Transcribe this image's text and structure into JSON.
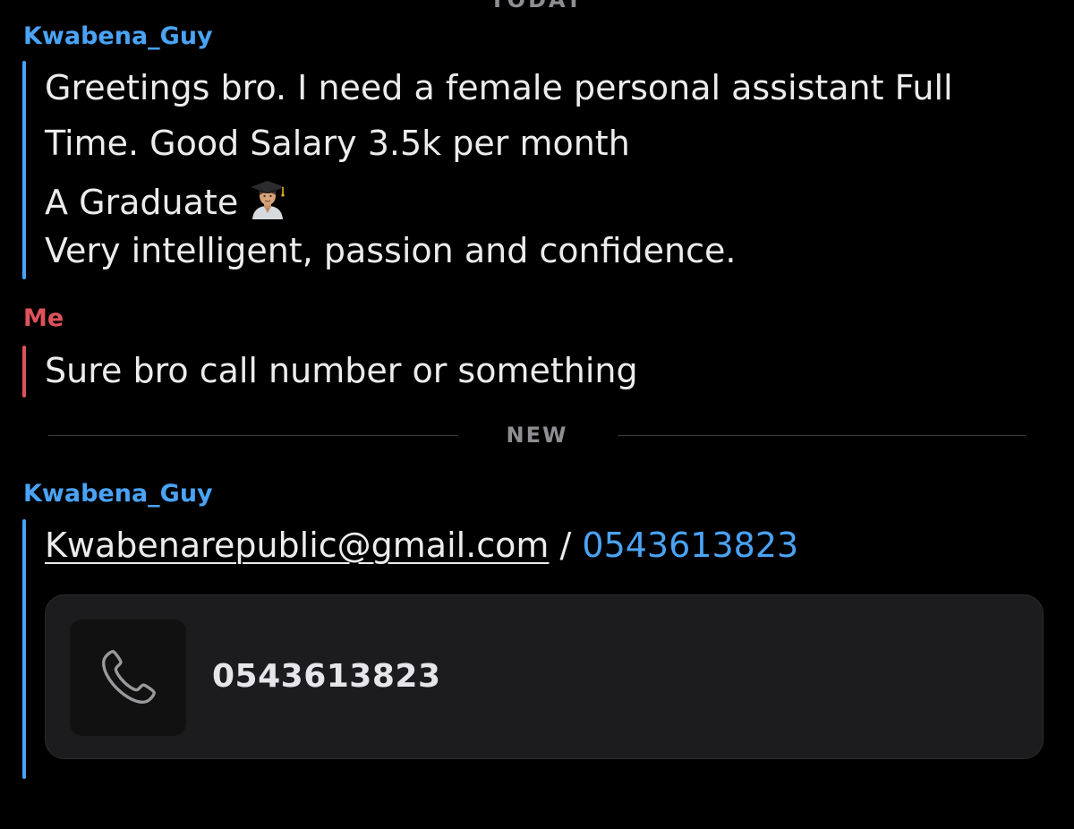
{
  "colors": {
    "background": "#000000",
    "friend_accent": "#4aa3f5",
    "me_accent": "#e0525a",
    "text": "#ececec",
    "muted": "#8e8e93",
    "card": "#1c1c1e"
  },
  "day_separator": "TODAY",
  "messages": [
    {
      "sender": "Kwabena_Guy",
      "lines": [
        "Greetings bro. I need a female personal assistant Full",
        "Time. Good Salary 3.5k per month",
        "A Graduate",
        "Very intelligent, passion and confidence."
      ],
      "emoji": "graduate-emoji-icon"
    },
    {
      "sender": "Me",
      "lines": [
        "Sure bro call number or something"
      ]
    },
    {
      "sender": "Kwabena_Guy",
      "email": "Kwabenarepublic@gmail.com",
      "separator": " / ",
      "phone": "0543613823",
      "contact_card": {
        "icon": "phone-icon",
        "number": "0543613823"
      }
    }
  ],
  "new_separator": "NEW"
}
